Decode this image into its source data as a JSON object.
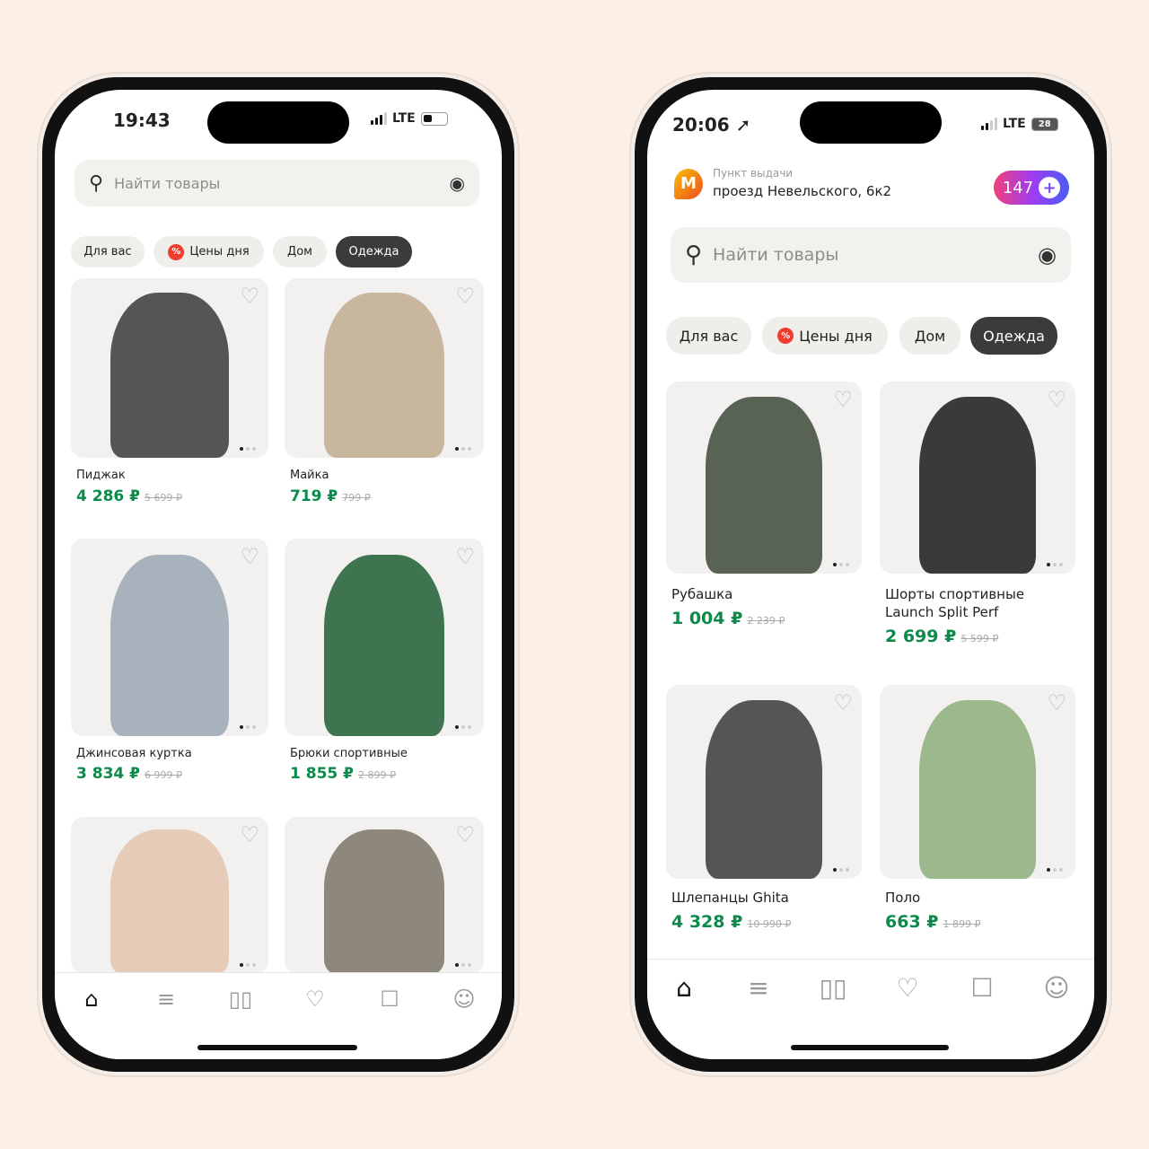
{
  "left_phone": {
    "time": "19:43",
    "network": "LTE",
    "search": {
      "placeholder": "Найти товары"
    },
    "chips": [
      {
        "label": "Для вас",
        "active": false
      },
      {
        "label": "Цены дня",
        "active": false,
        "icon": "percent-icon"
      },
      {
        "label": "Дом",
        "active": false
      },
      {
        "label": "Одежда",
        "active": true
      }
    ],
    "products": [
      {
        "title": "Пиджак",
        "price": "4 286 ₽",
        "old_price": "5 699 ₽",
        "image_color": "#3a3a3a"
      },
      {
        "title": "Майка",
        "price": "719 ₽",
        "old_price": "799 ₽",
        "image_color": "#c2ab90"
      },
      {
        "title": "Джинсовая куртка",
        "price": "3 834 ₽",
        "old_price": "6 999 ₽",
        "image_color": "#9aa7b4"
      },
      {
        "title": "Брюки спортивные",
        "price": "1 855 ₽",
        "old_price": "2 899 ₽",
        "image_color": "#1f5e34"
      },
      {
        "title": "",
        "price": "",
        "old_price": "",
        "image_color": "#e3c4ae"
      },
      {
        "title": "",
        "price": "",
        "old_price": "",
        "image_color": "#7d7466"
      }
    ],
    "tabs": [
      "home-icon",
      "catalog-search-icon",
      "compare-icon",
      "favorites-heart-icon",
      "cart-icon",
      "profile-icon"
    ]
  },
  "right_phone": {
    "time": "20:06",
    "network": "LTE",
    "battery": "28",
    "pickup": {
      "label": "Пункт выдачи",
      "address": "проезд Невельского, 6к2"
    },
    "points_badge": "147",
    "search": {
      "placeholder": "Найти товары"
    },
    "chips": [
      {
        "label": "Для вас",
        "active": false
      },
      {
        "label": "Цены дня",
        "active": false,
        "icon": "percent-icon"
      },
      {
        "label": "Дом",
        "active": false
      },
      {
        "label": "Одежда",
        "active": true
      }
    ],
    "products": [
      {
        "title": "Рубашка",
        "price": "1 004 ₽",
        "old_price": "2 239 ₽",
        "image_color": "#3e4a3a"
      },
      {
        "title": "Шорты спортивные Launch Split Perf",
        "price": "2 699 ₽",
        "old_price": "5 599 ₽",
        "image_color": "#1a1a1a"
      },
      {
        "title": "Шлепанцы Ghita",
        "price": "4 328 ₽",
        "old_price": "10 990 ₽",
        "image_color": "#3a3a3a"
      },
      {
        "title": "Поло",
        "price": "663 ₽",
        "old_price": "1 899 ₽",
        "image_color": "#8fae7c"
      }
    ],
    "tabs": [
      "home-icon",
      "catalog-search-icon",
      "compare-icon",
      "favorites-heart-icon",
      "cart-icon",
      "profile-icon"
    ]
  },
  "colors": {
    "background": "#fbefe6",
    "price_green": "#0c8a4a",
    "active_chip": "#3b3b3b",
    "sale_red": "#f03d2e"
  }
}
